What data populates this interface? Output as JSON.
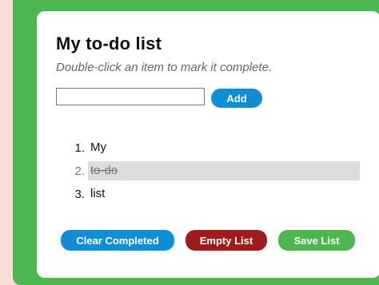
{
  "header": {
    "title": "My to-do list",
    "subtitle": "Double-click an item to mark it complete."
  },
  "new_item": {
    "value": "",
    "placeholder": "",
    "add_label": "Add"
  },
  "todo": {
    "items": [
      {
        "number": "1.",
        "text": "My",
        "completed": false
      },
      {
        "number": "2.",
        "text": "to-do",
        "completed": true
      },
      {
        "number": "3.",
        "text": "list",
        "completed": false
      }
    ]
  },
  "actions": {
    "clear_completed_label": "Clear Completed",
    "empty_list_label": "Empty List",
    "save_list_label": "Save List"
  },
  "colors": {
    "page_background": "#f9ddd8",
    "frame": "#4cb74f",
    "primary_button": "#0f8ed6",
    "danger_button": "#a01c1c",
    "success_button": "#4cb74f",
    "completed_highlight": "#dcdcdc"
  }
}
